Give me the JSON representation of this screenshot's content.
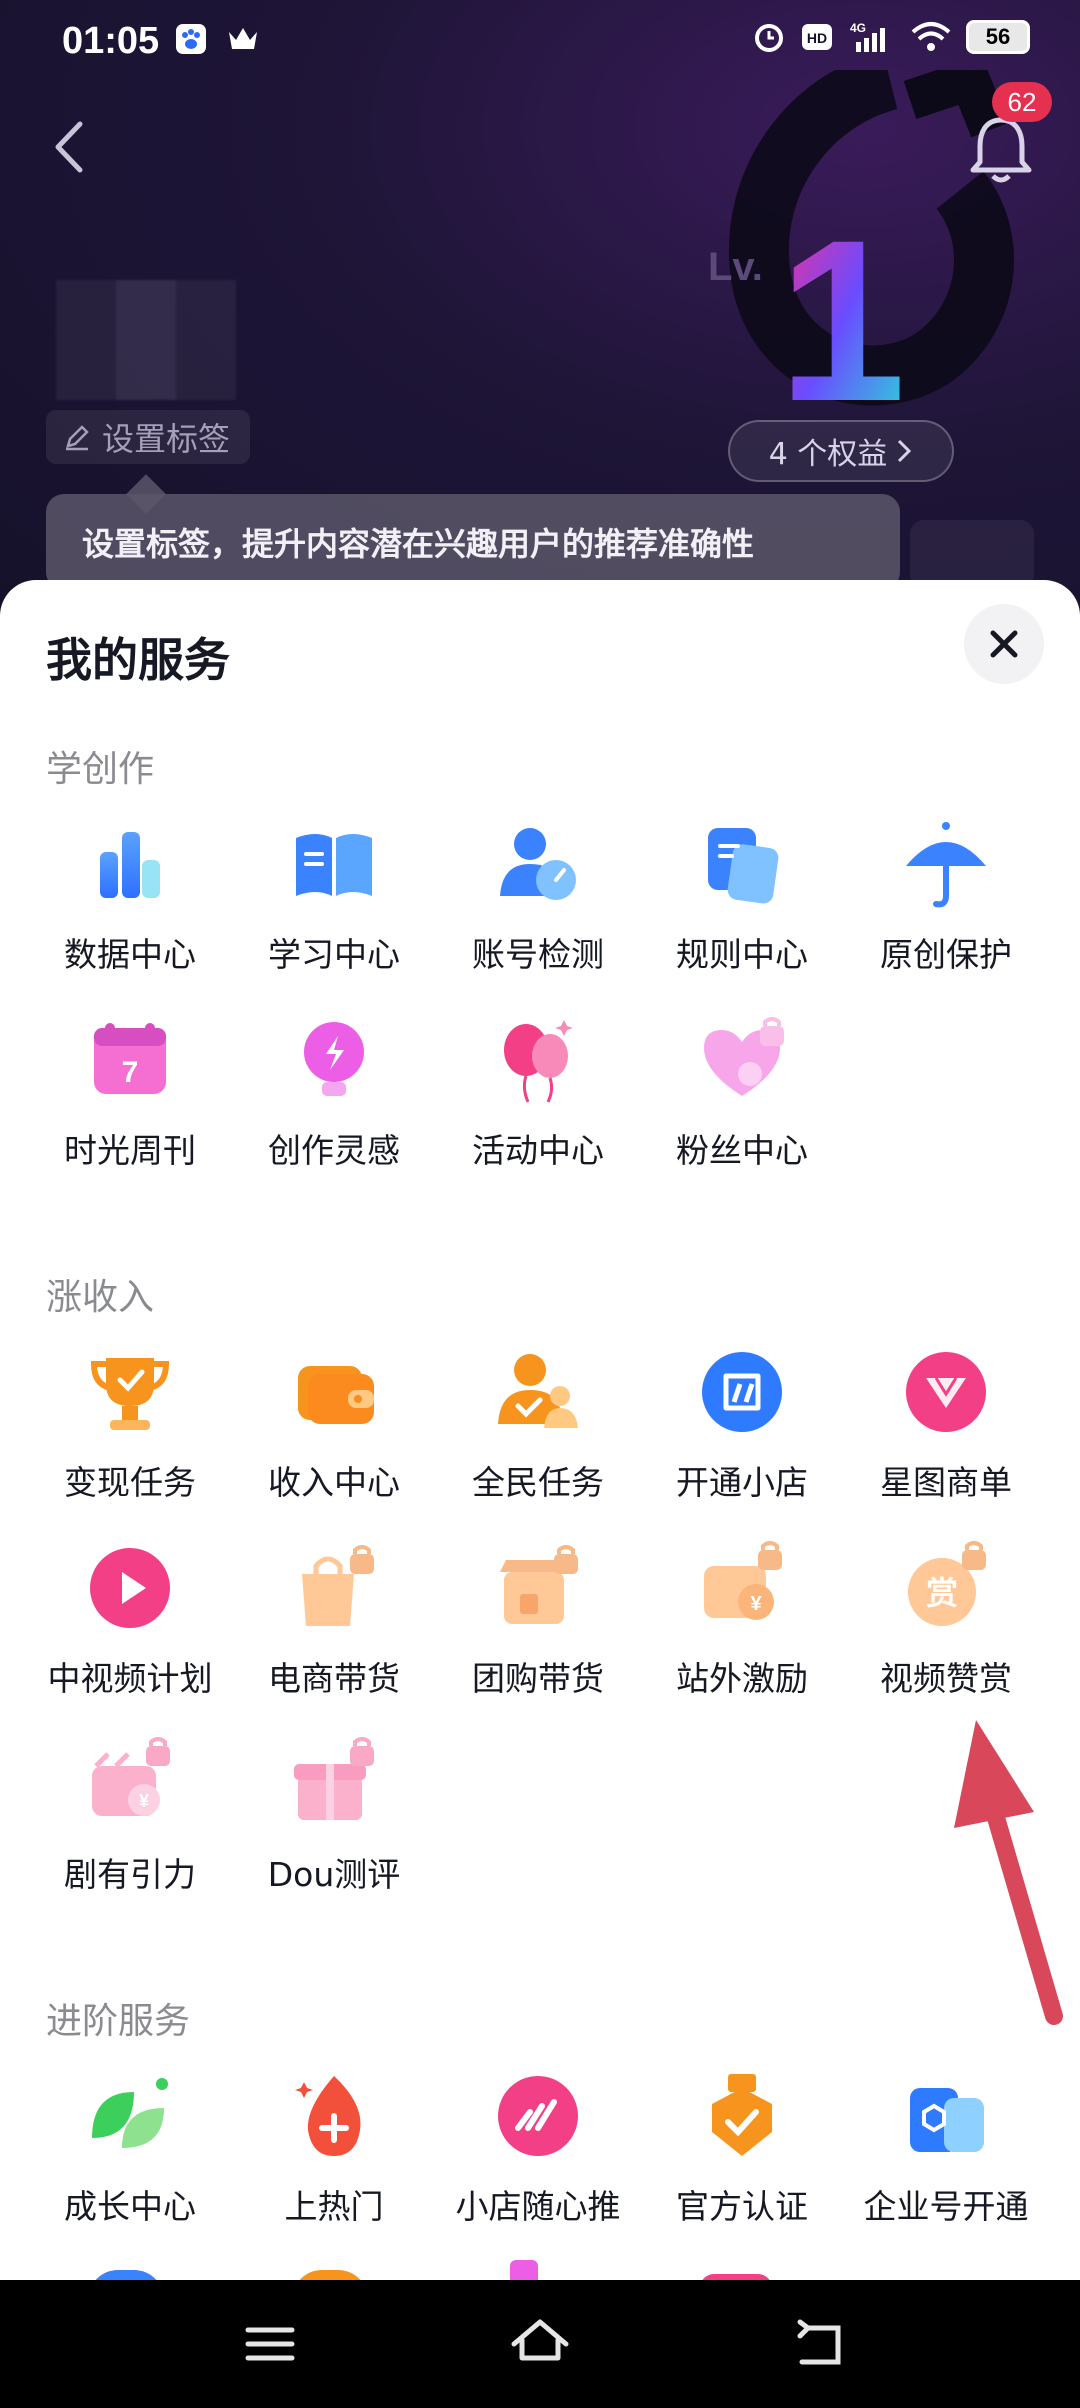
{
  "status_bar": {
    "time": "01:05",
    "network": "4G",
    "hd": "HD",
    "battery": "56"
  },
  "header": {
    "notification_count": "62",
    "level_text": "Lv.",
    "level_number": "1",
    "benefits": "4 个权益",
    "set_tag": "设置标签",
    "tooltip": "设置标签，提升内容潜在兴趣用户的推荐准确性"
  },
  "sheet": {
    "title": "我的服务",
    "sections": [
      {
        "title": "学创作",
        "items": [
          {
            "label": "数据中心",
            "icon": "bar-chart-icon"
          },
          {
            "label": "学习中心",
            "icon": "open-book-icon"
          },
          {
            "label": "账号检测",
            "icon": "user-gauge-icon"
          },
          {
            "label": "规则中心",
            "icon": "documents-icon"
          },
          {
            "label": "原创保护",
            "icon": "umbrella-icon"
          },
          {
            "label": "时光周刊",
            "icon": "calendar-icon"
          },
          {
            "label": "创作灵感",
            "icon": "lightbulb-icon"
          },
          {
            "label": "活动中心",
            "icon": "balloons-icon"
          },
          {
            "label": "粉丝中心",
            "icon": "heart-locked-icon"
          }
        ]
      },
      {
        "title": "涨收入",
        "items": [
          {
            "label": "变现任务",
            "icon": "trophy-icon"
          },
          {
            "label": "收入中心",
            "icon": "wallet-icon"
          },
          {
            "label": "全民任务",
            "icon": "people-check-icon"
          },
          {
            "label": "开通小店",
            "icon": "shop-icon"
          },
          {
            "label": "星图商单",
            "icon": "star-map-icon"
          },
          {
            "label": "中视频计划",
            "icon": "play-icon"
          },
          {
            "label": "电商带货",
            "icon": "shopping-bag-locked-icon"
          },
          {
            "label": "团购带货",
            "icon": "store-locked-icon"
          },
          {
            "label": "站外激励",
            "icon": "video-yen-locked-icon"
          },
          {
            "label": "视频赞赏",
            "icon": "reward-locked-icon"
          },
          {
            "label": "剧有引力",
            "icon": "drama-yen-locked-icon"
          },
          {
            "label": "Dou测评",
            "icon": "gift-locked-icon"
          }
        ]
      },
      {
        "title": "进阶服务",
        "items": [
          {
            "label": "成长中心",
            "icon": "leaf-icon"
          },
          {
            "label": "上热门",
            "icon": "flame-plus-icon"
          },
          {
            "label": "小店随心推",
            "icon": "speed-icon"
          },
          {
            "label": "官方认证",
            "icon": "badge-check-icon"
          },
          {
            "label": "企业号开通",
            "icon": "enterprise-icon"
          }
        ]
      }
    ]
  },
  "colors": {
    "accent": "#e6304f",
    "sheet_bg": "#ffffff",
    "section_title": "#8a8b91"
  }
}
